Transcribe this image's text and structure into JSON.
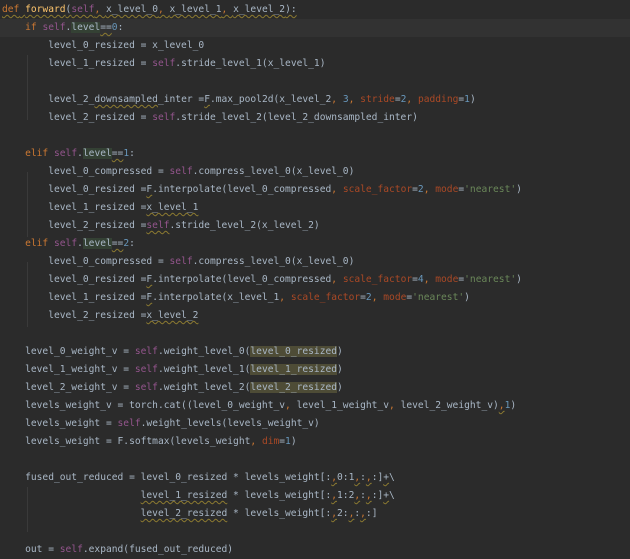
{
  "editor": {
    "theme_colors": {
      "background": "#2b2b2b",
      "text": "#a9b7c6",
      "keyword": "#cc7832",
      "self": "#94558d",
      "number": "#6897bb",
      "string": "#6a8759",
      "kwarg": "#aa4926",
      "function": "#ffc66d"
    },
    "current_line": 1,
    "lines": [
      [
        [
          "def",
          "kw w"
        ],
        [
          " ",
          "w"
        ],
        [
          "forward",
          "fn w"
        ],
        [
          "(",
          "w"
        ],
        [
          "self",
          "self w"
        ],
        [
          ", ",
          "punc w"
        ],
        [
          "x_level_0",
          "w"
        ],
        [
          ", ",
          "punc w"
        ],
        [
          "x_level_1",
          "w"
        ],
        [
          ", ",
          "punc w"
        ],
        [
          "x_level_2",
          "w"
        ],
        [
          "):",
          "w"
        ]
      ],
      [
        [
          "    "
        ],
        [
          "if ",
          "kw"
        ],
        [
          "self",
          "self"
        ],
        [
          "."
        ],
        [
          "level",
          "hl"
        ],
        [
          "==",
          "w"
        ],
        [
          "0",
          "num"
        ],
        [
          ":"
        ]
      ],
      [
        [
          "        level_0_resized = x_level_0"
        ]
      ],
      [
        [
          "        level_1_resized = "
        ],
        [
          "self",
          "self"
        ],
        [
          ".stride_level_1(x_level_1)"
        ]
      ],
      [
        [
          ""
        ]
      ],
      [
        [
          "        level_2_"
        ],
        [
          "downsampled",
          "w"
        ],
        [
          "_inter ="
        ],
        [
          "F",
          "w"
        ],
        [
          ".max_pool2d(x_level_2"
        ],
        [
          ", ",
          "punc"
        ],
        [
          "3",
          "num"
        ],
        [
          ", ",
          "punc"
        ],
        [
          "stride",
          "kwarg"
        ],
        [
          "="
        ],
        [
          "2",
          "num"
        ],
        [
          ", ",
          "punc"
        ],
        [
          "padding",
          "kwarg"
        ],
        [
          "="
        ],
        [
          "1",
          "num"
        ],
        [
          ")"
        ]
      ],
      [
        [
          "        level_2_resized = "
        ],
        [
          "self",
          "self"
        ],
        [
          ".stride_level_2(level_2_downsampled_inter)"
        ]
      ],
      [
        [
          ""
        ]
      ],
      [
        [
          "    "
        ],
        [
          "elif ",
          "kw"
        ],
        [
          "self",
          "self"
        ],
        [
          "."
        ],
        [
          "level",
          "hl"
        ],
        [
          "==",
          "w"
        ],
        [
          "1",
          "num"
        ],
        [
          ":"
        ]
      ],
      [
        [
          "        level_0_compressed = "
        ],
        [
          "self",
          "self"
        ],
        [
          ".compress_level_0(x_level_0)"
        ]
      ],
      [
        [
          "        level_0_resized ="
        ],
        [
          "F",
          "w"
        ],
        [
          ".interpolate(level_0_compressed"
        ],
        [
          ", ",
          "punc"
        ],
        [
          "scale_factor",
          "kwarg"
        ],
        [
          "="
        ],
        [
          "2",
          "num"
        ],
        [
          ", ",
          "punc"
        ],
        [
          "mode",
          "kwarg"
        ],
        [
          "="
        ],
        [
          "'nearest'",
          "str"
        ],
        [
          ")"
        ]
      ],
      [
        [
          "        level_1_resized ="
        ],
        [
          "x_level_1",
          "w"
        ]
      ],
      [
        [
          "        level_2_resized ="
        ],
        [
          "self",
          "self w"
        ],
        [
          ".stride_level_2(x_level_2)"
        ]
      ],
      [
        [
          "    "
        ],
        [
          "elif ",
          "kw"
        ],
        [
          "self",
          "self"
        ],
        [
          "."
        ],
        [
          "level",
          "hl"
        ],
        [
          "==",
          "w"
        ],
        [
          "2",
          "num"
        ],
        [
          ":"
        ]
      ],
      [
        [
          "        level_0_compressed = "
        ],
        [
          "self",
          "self"
        ],
        [
          ".compress_level_0(x_level_0)"
        ]
      ],
      [
        [
          "        level_0_resized ="
        ],
        [
          "F",
          "w"
        ],
        [
          ".interpolate(level_0_compressed"
        ],
        [
          ", ",
          "punc"
        ],
        [
          "scale_factor",
          "kwarg"
        ],
        [
          "="
        ],
        [
          "4",
          "num"
        ],
        [
          ", ",
          "punc"
        ],
        [
          "mode",
          "kwarg"
        ],
        [
          "="
        ],
        [
          "'nearest'",
          "str"
        ],
        [
          ")"
        ]
      ],
      [
        [
          "        level_1_resized ="
        ],
        [
          "F",
          "w"
        ],
        [
          ".interpolate(x_level_1"
        ],
        [
          ", ",
          "punc"
        ],
        [
          "scale_factor",
          "kwarg"
        ],
        [
          "="
        ],
        [
          "2",
          "num"
        ],
        [
          ", ",
          "punc"
        ],
        [
          "mode",
          "kwarg"
        ],
        [
          "="
        ],
        [
          "'nearest'",
          "str"
        ],
        [
          ")"
        ]
      ],
      [
        [
          "        level_2_resized ="
        ],
        [
          "x_level_2",
          "w"
        ]
      ],
      [
        [
          ""
        ]
      ],
      [
        [
          "    level_0_weight_v = "
        ],
        [
          "self",
          "self"
        ],
        [
          ".weight_level_0("
        ],
        [
          "level_0_resized",
          "arg"
        ],
        [
          ")"
        ]
      ],
      [
        [
          "    level_1_weight_v = "
        ],
        [
          "self",
          "self"
        ],
        [
          ".weight_level_1("
        ],
        [
          "level_1_resized",
          "arg"
        ],
        [
          ")"
        ]
      ],
      [
        [
          "    level_2_weight_v = "
        ],
        [
          "self",
          "self"
        ],
        [
          ".weight_level_2("
        ],
        [
          "level_2_resized",
          "arg"
        ],
        [
          ")"
        ]
      ],
      [
        [
          "    levels_weight_v = torch.cat((level_0_weight_v"
        ],
        [
          ", ",
          "punc"
        ],
        [
          "level_1_weight_v"
        ],
        [
          ", ",
          "punc"
        ],
        [
          "level_2_weight_v)"
        ],
        [
          ",",
          "punc w"
        ],
        [
          "1",
          "num"
        ],
        [
          ")"
        ]
      ],
      [
        [
          "    levels_weight = "
        ],
        [
          "self",
          "self"
        ],
        [
          ".weight_levels(levels_weight_v)"
        ]
      ],
      [
        [
          "    levels_weight = F.softmax(levels_weight"
        ],
        [
          ", ",
          "punc"
        ],
        [
          "dim",
          "kwarg"
        ],
        [
          "="
        ],
        [
          "1",
          "num"
        ],
        [
          ")"
        ]
      ],
      [
        [
          ""
        ]
      ],
      [
        [
          "    fused_out_reduced = level_0_resized * levels_weight[:"
        ],
        [
          ",",
          "punc w"
        ],
        [
          "0:1"
        ],
        [
          ",",
          "punc w"
        ],
        [
          ":"
        ],
        [
          ",",
          "punc w"
        ],
        [
          ":]"
        ],
        [
          "+",
          "w"
        ],
        [
          "\\"
        ]
      ],
      [
        [
          "                        "
        ],
        [
          "level_1_resized",
          "w"
        ],
        [
          " * levels_weight[:"
        ],
        [
          ",",
          "punc w"
        ],
        [
          "1:2"
        ],
        [
          ",",
          "punc w"
        ],
        [
          ":"
        ],
        [
          ",",
          "punc w"
        ],
        [
          ":]"
        ],
        [
          "+",
          "w"
        ],
        [
          "\\"
        ]
      ],
      [
        [
          "                        "
        ],
        [
          "level_2_resized",
          "w"
        ],
        [
          " * levels_weight[:"
        ],
        [
          ",",
          "punc w"
        ],
        [
          "2:"
        ],
        [
          ",",
          "punc w"
        ],
        [
          ":"
        ],
        [
          ",",
          "punc w"
        ],
        [
          ":]"
        ]
      ],
      [
        [
          ""
        ]
      ],
      [
        [
          "    out = "
        ],
        [
          "self",
          "self"
        ],
        [
          ".expand(fused_out_reduced)"
        ]
      ]
    ]
  }
}
